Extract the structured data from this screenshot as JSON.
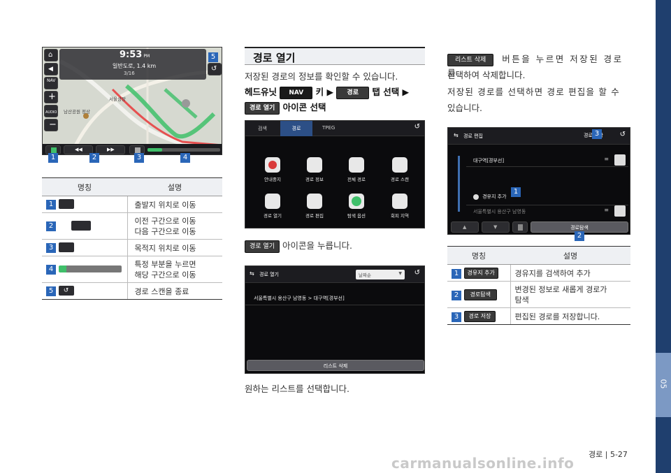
{
  "section": {
    "title": "경로 열기",
    "intro": "저장된 경로의 정보를 확인할 수 있습니다.",
    "step_prefix": "헤드유닛",
    "key_nav": "NAV",
    "step_key": "키 ▶",
    "tab_route": "경로",
    "step_tab": "탭 선택 ▶",
    "icon_open": "경로 열기",
    "step_icon": "아이콘 선택",
    "press_chip": "경로 열기",
    "press_text": "아이콘을 누릅니다.",
    "select_text": "원하는 리스트를 선택합니다."
  },
  "right": {
    "delete_chip": "리스트 삭제",
    "delete_text_1": "버튼을 누르면 저장된 경로를",
    "delete_text_2": "선택하여 삭제합니다.",
    "edit_text_1": "저장된 경로를 선택하면 경로 편집을 할 수",
    "edit_text_2": "있습니다."
  },
  "map_screen": {
    "time": "9:53",
    "time_suffix": "PM",
    "road": "일반도로, 1.4 km",
    "page": "3/16",
    "place1": "서울광장",
    "place2": "남산공원 정상",
    "nav_label": "NAV",
    "audio_label": "AUDIO",
    "side_labels": [
      "5"
    ],
    "markers": [
      "1",
      "2",
      "3",
      "4",
      "5"
    ]
  },
  "table1": {
    "headers": [
      "명칭",
      "설명"
    ],
    "rows": [
      {
        "num": "1",
        "desc": [
          "출발지 위치로 이동"
        ]
      },
      {
        "num": "2",
        "desc": [
          "이전 구간으로 이동",
          "다음 구간으로 이동"
        ]
      },
      {
        "num": "3",
        "desc": [
          "목적지 위치로 이동"
        ]
      },
      {
        "num": "4",
        "desc": [
          "특정 부분을 누르면",
          "해당 구간으로 이동"
        ]
      },
      {
        "num": "5",
        "desc": [
          "경로 스캔을 종료"
        ]
      }
    ]
  },
  "route_menu": {
    "tabs": [
      "검색",
      "경로",
      "TPEG"
    ],
    "items": [
      "안내중지",
      "경로 정보",
      "전체 경로",
      "경로 스캔",
      "경로 열기",
      "경로 편집",
      "탐색 옵션",
      "회피 지역"
    ]
  },
  "open_screen": {
    "title": "경로 열기",
    "sort": "날짜순",
    "item": "서울특별시 용산구 남영동 > 대구역[경부선]",
    "delete": "리스트 삭제"
  },
  "edit_screen": {
    "title": "경로 편집",
    "save": "경로 저장",
    "dest": "대구역[경부선]",
    "add_waypoint": "경유지 추가",
    "start": "서울특별시 용산구 남영동",
    "search": "경로탐색",
    "markers": [
      "1",
      "2",
      "3"
    ]
  },
  "table2": {
    "headers": [
      "명칭",
      "설명"
    ],
    "rows": [
      {
        "num": "1",
        "chip": "경유지 추가",
        "desc": [
          "경유지를 검색하여 추가"
        ]
      },
      {
        "num": "2",
        "chip": "경로탐색",
        "desc": [
          "변경된 정보로 새롭게 경로가",
          "탐색"
        ]
      },
      {
        "num": "3",
        "chip": "경로 저장",
        "desc": [
          "편집된 경로를 저장합니다."
        ]
      }
    ]
  },
  "footer": {
    "page": "경로 | 5-27",
    "chapter": "05",
    "watermark": "carmanualsonline.info"
  },
  "colors": {
    "accent": "#2a66b8",
    "sidebar": "#1f3f6e",
    "sidebar_tab": "#7c99c4",
    "route": "#3fbf6a"
  }
}
